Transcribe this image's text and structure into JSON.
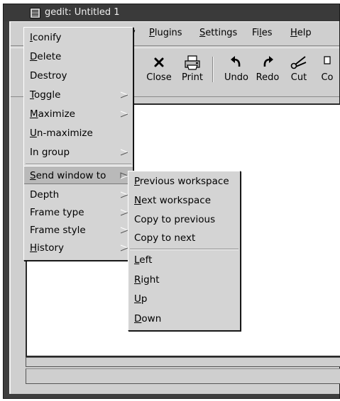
{
  "window": {
    "title": "gedit: Untitled 1"
  },
  "menubar": {
    "items": [
      {
        "label": "View",
        "visible_fragment": "v"
      },
      {
        "label": "Plugins"
      },
      {
        "label": "Settings"
      },
      {
        "label": "Files"
      },
      {
        "label": "Help"
      }
    ]
  },
  "toolbar": {
    "buttons": [
      {
        "label": "e",
        "icon": "save-icon"
      },
      {
        "label": "Close",
        "icon": "close-x-icon"
      },
      {
        "label": "Print",
        "icon": "printer-icon"
      },
      {
        "label": "Undo",
        "icon": "undo-icon"
      },
      {
        "label": "Redo",
        "icon": "redo-icon"
      },
      {
        "label": "Cut",
        "icon": "scissors-icon"
      },
      {
        "label": "Co",
        "icon": "copy-icon"
      }
    ]
  },
  "window_menu": {
    "items": [
      {
        "label": "Iconify",
        "accel": "I",
        "rest": "conify",
        "submenu": false
      },
      {
        "label": "Delete",
        "accel": "D",
        "rest": "elete",
        "submenu": false
      },
      {
        "label": "Destroy",
        "submenu": false
      },
      {
        "label": "Toggle",
        "accel": "T",
        "rest": "oggle",
        "submenu": true
      },
      {
        "label": "Maximize",
        "accel": "M",
        "rest": "aximize",
        "submenu": true
      },
      {
        "label": "Un-maximize",
        "accel": "U",
        "rest": "n-maximize",
        "submenu": false
      },
      {
        "label": "In group",
        "submenu": true
      },
      {
        "label": "Send window to",
        "accel": "S",
        "rest": "end window to",
        "submenu": true,
        "active": true
      },
      {
        "label": "Depth",
        "submenu": true
      },
      {
        "label": "Frame type",
        "submenu": true
      },
      {
        "label": "Frame style",
        "submenu": true
      },
      {
        "label": "History",
        "accel": "H",
        "rest": "istory",
        "submenu": true
      }
    ]
  },
  "send_to_menu": {
    "workspace_items": [
      {
        "label": "Previous workspace",
        "accel": "P",
        "rest": "revious workspace"
      },
      {
        "label": "Next workspace",
        "accel": "N",
        "rest": "ext workspace"
      },
      {
        "label": "Copy to previous"
      },
      {
        "label": "Copy to next"
      }
    ],
    "direction_items": [
      {
        "label": "Left",
        "accel": "L",
        "rest": "eft"
      },
      {
        "label": "Right",
        "accel": "R",
        "rest": "ight"
      },
      {
        "label": "Up",
        "accel": "U",
        "rest": "p"
      },
      {
        "label": "Down",
        "accel": "D",
        "rest": "own"
      }
    ]
  },
  "colors": {
    "frame": "#3e3e3e",
    "menu_bg": "#d4d4d4",
    "window_bg": "#cfcfcf",
    "text_area": "#ffffff"
  }
}
